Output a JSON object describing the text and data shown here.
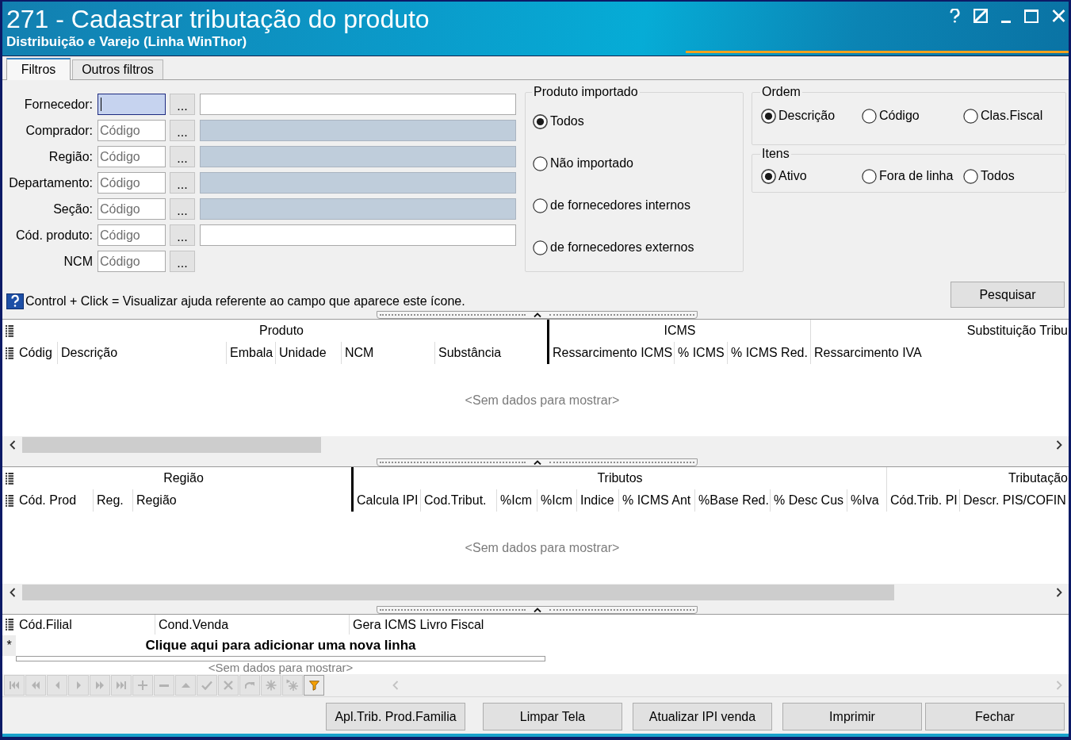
{
  "window": {
    "title": "271 - Cadastrar tributação do produto",
    "subtitle": "Distribuição e Varejo (Linha WinThor)"
  },
  "tabs": [
    {
      "label": "Filtros",
      "selected": true
    },
    {
      "label": "Outros filtros",
      "selected": false
    }
  ],
  "filters": [
    {
      "label": "Fornecedor:",
      "code": {
        "focused": true
      },
      "lookup": "...",
      "description": {
        "disabled": false
      }
    },
    {
      "label": "Comprador:",
      "code": {
        "placeholder": "Código",
        "focused": false
      },
      "lookup": "...",
      "description": {
        "disabled": true
      }
    },
    {
      "label": "Região:",
      "code": {
        "placeholder": "Código",
        "focused": false
      },
      "lookup": "...",
      "description": {
        "disabled": true
      }
    },
    {
      "label": "Departamento:",
      "code": {
        "placeholder": "Código",
        "focused": false
      },
      "lookup": "...",
      "description": {
        "disabled": true
      }
    },
    {
      "label": "Seção:",
      "code": {
        "placeholder": "Código",
        "focused": false
      },
      "lookup": "...",
      "description": {
        "disabled": true
      }
    },
    {
      "label": "Cód. produto:",
      "code": {
        "placeholder": "Código",
        "focused": false
      },
      "lookup": "...",
      "description": {
        "disabled": false
      }
    },
    {
      "label": "NCM",
      "code": {
        "placeholder": "Código",
        "focused": false
      },
      "lookup": "..."
    }
  ],
  "imported_product": {
    "title": "Produto importado",
    "options": [
      {
        "label": "Todos",
        "selected": true
      },
      {
        "label": "Não importado",
        "selected": false
      },
      {
        "label": "de fornecedores internos",
        "selected": false
      },
      {
        "label": "de fornecedores externos",
        "selected": false
      }
    ]
  },
  "order": {
    "title": "Ordem",
    "options": [
      {
        "label": "Descrição",
        "selected": true
      },
      {
        "label": "Código",
        "selected": false
      },
      {
        "label": "Clas.Fiscal",
        "selected": false
      }
    ]
  },
  "items": {
    "title": "Itens",
    "options": [
      {
        "label": "Ativo",
        "selected": true
      },
      {
        "label": "Fora de linha",
        "selected": false
      },
      {
        "label": "Todos",
        "selected": false
      }
    ]
  },
  "help_hint": "Control + Click = Visualizar ajuda referente ao campo que aparece este ícone.",
  "search_button": "Pesquisar",
  "grids": [
    {
      "bands": [
        {
          "label": "Produto",
          "columns": [
            "Códig",
            "Descrição",
            "Embala",
            "Unidade",
            "NCM",
            "Substância"
          ]
        },
        {
          "label": "ICMS",
          "columns": [
            "Ressarcimento ICMS",
            "% ICMS",
            "% ICMS Red."
          ]
        },
        {
          "label": "Substituição Tribu",
          "columns": [
            "Ressarcimento IVA"
          ]
        }
      ],
      "empty_text": "<Sem dados para mostrar>"
    },
    {
      "bands": [
        {
          "label": "Região",
          "columns": [
            "Cód. Prod",
            "Reg.",
            "Região"
          ]
        },
        {
          "label": "Tributos",
          "columns": [
            "Calcula IPI",
            "Cod.Tribut.",
            "%Icm",
            "%Icm",
            "Indice",
            "% ICMS Ant",
            "%Base Red.",
            "% Desc Cus",
            "%Iva"
          ]
        },
        {
          "label": "Tributação",
          "columns": [
            "Cód.Trib. PI",
            "Descr. PIS/COFIN"
          ]
        }
      ],
      "empty_text": "<Sem dados para mostrar>"
    }
  ],
  "detail_grid": {
    "columns": [
      "Cód.Filial",
      "Cond.Venda",
      "Gera ICMS Livro Fiscal"
    ],
    "new_row_marker": "*",
    "new_row_text": "Clique aqui para adicionar uma nova linha",
    "empty_text": "<Sem dados para mostrar>"
  },
  "navigator": [
    {
      "disabled": true
    },
    {
      "disabled": true
    },
    {
      "disabled": true
    },
    {
      "disabled": true
    },
    {
      "disabled": true
    },
    {
      "disabled": true
    },
    {
      "disabled": true
    },
    {
      "disabled": true
    },
    {
      "disabled": true
    },
    {
      "disabled": true
    },
    {
      "disabled": true
    },
    {
      "disabled": true
    },
    {
      "disabled": true
    },
    {
      "disabled": true
    },
    {
      "disabled": false
    }
  ],
  "buttons": [
    "Apl.Trib. Prod.Familia",
    "Limpar Tela",
    "Atualizar IPI venda",
    "Imprimir",
    "Fechar"
  ]
}
